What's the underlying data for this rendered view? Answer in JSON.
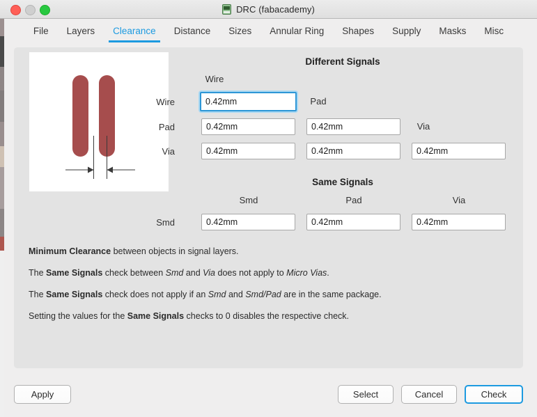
{
  "window": {
    "title": "DRC (fabacademy)",
    "icon": "drc-board-icon",
    "controls": {
      "close": "close",
      "minimize": "minimize",
      "zoom": "zoom"
    }
  },
  "tabs": [
    {
      "label": "File",
      "active": false
    },
    {
      "label": "Layers",
      "active": false
    },
    {
      "label": "Clearance",
      "active": true
    },
    {
      "label": "Distance",
      "active": false
    },
    {
      "label": "Sizes",
      "active": false
    },
    {
      "label": "Annular Ring",
      "active": false
    },
    {
      "label": "Shapes",
      "active": false
    },
    {
      "label": "Supply",
      "active": false
    },
    {
      "label": "Masks",
      "active": false
    },
    {
      "label": "Misc",
      "active": false
    }
  ],
  "illustration": {
    "name": "wire-clearance-diagram",
    "wire_color": "#a64d4d",
    "background": "#ffffff",
    "line_color": "#3a3a3a"
  },
  "different_signals": {
    "title": "Different Signals",
    "col_headers": [
      "Wire",
      "Pad",
      "Via"
    ],
    "rows": [
      {
        "label": "Wire",
        "values": [
          "0.42mm"
        ]
      },
      {
        "label": "Pad",
        "values": [
          "0.42mm",
          "0.42mm"
        ]
      },
      {
        "label": "Via",
        "values": [
          "0.42mm",
          "0.42mm",
          "0.42mm"
        ]
      }
    ],
    "focused_field": "wire-wire"
  },
  "same_signals": {
    "title": "Same Signals",
    "col_headers": [
      "Smd",
      "Pad",
      "Via"
    ],
    "rows": [
      {
        "label": "Smd",
        "values": [
          "0.42mm",
          "0.42mm",
          "0.42mm"
        ]
      }
    ]
  },
  "descriptions": [
    {
      "id": "d1",
      "parts": [
        {
          "t": "Minimum Clearance",
          "s": "b"
        },
        {
          "t": " between objects in signal layers.",
          "s": "n"
        }
      ]
    },
    {
      "id": "d2",
      "parts": [
        {
          "t": "The ",
          "s": "n"
        },
        {
          "t": "Same Signals",
          "s": "b"
        },
        {
          "t": " check between ",
          "s": "n"
        },
        {
          "t": "Smd",
          "s": "i"
        },
        {
          "t": " and ",
          "s": "n"
        },
        {
          "t": "Via",
          "s": "i"
        },
        {
          "t": " does not apply to ",
          "s": "n"
        },
        {
          "t": "Micro Vias",
          "s": "i"
        },
        {
          "t": ".",
          "s": "n"
        }
      ]
    },
    {
      "id": "d3",
      "parts": [
        {
          "t": "The ",
          "s": "n"
        },
        {
          "t": "Same Signals",
          "s": "b"
        },
        {
          "t": " check does not apply if an ",
          "s": "n"
        },
        {
          "t": "Smd",
          "s": "i"
        },
        {
          "t": " and ",
          "s": "n"
        },
        {
          "t": "Smd/Pad",
          "s": "i"
        },
        {
          "t": " are in the same package.",
          "s": "n"
        }
      ]
    },
    {
      "id": "d4",
      "parts": [
        {
          "t": "Setting the values for the ",
          "s": "n"
        },
        {
          "t": "Same Signals",
          "s": "b"
        },
        {
          "t": " checks to 0 disables the respective check.",
          "s": "n"
        }
      ]
    }
  ],
  "buttons": {
    "apply": "Apply",
    "select": "Select",
    "cancel": "Cancel",
    "check": "Check"
  },
  "colors": {
    "accent": "#1c9ae0",
    "panel": "#e3e3e3",
    "window": "#efeeee",
    "wire": "#a64d4d"
  }
}
